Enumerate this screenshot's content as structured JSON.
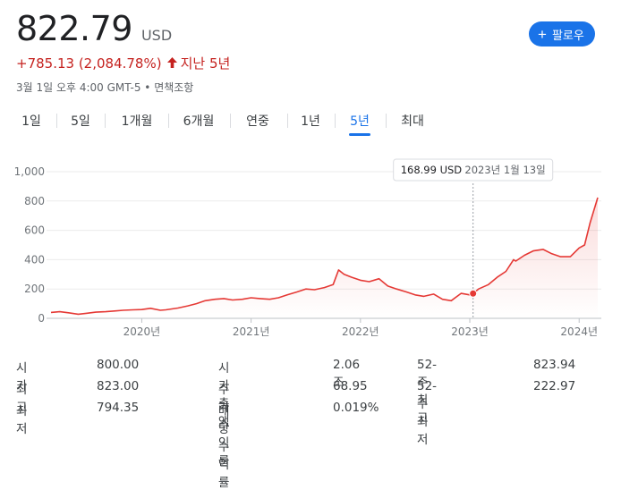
{
  "quote": {
    "price": "822.79",
    "currency": "USD",
    "change": "+785.13 (2,084.78%)",
    "arrow_icon": "arrow-up-icon",
    "period_label": "지난 5년",
    "timestamp": "3월 1일 오후 4:00 GMT-5 • 면책조항"
  },
  "follow_button": {
    "label": "팔로우",
    "icon": "plus-icon",
    "color": "#1a73e8"
  },
  "tabs": [
    {
      "label": "1일",
      "active": false
    },
    {
      "label": "5일",
      "active": false
    },
    {
      "label": "1개월",
      "active": false
    },
    {
      "label": "6개월",
      "active": false
    },
    {
      "label": "연중",
      "active": false
    },
    {
      "label": "1년",
      "active": false
    },
    {
      "label": "5년",
      "active": true
    },
    {
      "label": "최대",
      "active": false
    }
  ],
  "tooltip": {
    "price": "168.99 USD",
    "date": "2023년 1월 13일"
  },
  "chart_data": {
    "type": "area",
    "line_color": "#e53935",
    "grid": true,
    "ylim": [
      0,
      1000
    ],
    "yticks": [
      "1,000",
      "800",
      "600",
      "400",
      "200",
      "0"
    ],
    "ytick_values": [
      1000,
      800,
      600,
      400,
      200,
      0
    ],
    "xticks": [
      "2020년",
      "2021년",
      "2022년",
      "2023년",
      "2024년"
    ],
    "xtick_values": [
      2020.0,
      2021.0,
      2022.0,
      2023.0,
      2024.0
    ],
    "xlim": [
      2019.17,
      2024.17
    ],
    "highlight": {
      "x": 2023.03,
      "y": 168.99
    },
    "series": [
      {
        "x": [
          2019.17,
          2019.25,
          2019.33,
          2019.42,
          2019.5,
          2019.58,
          2019.67,
          2019.75,
          2019.83,
          2019.92,
          2020.0,
          2020.08,
          2020.17,
          2020.22,
          2020.33,
          2020.42,
          2020.5,
          2020.58,
          2020.67,
          2020.75,
          2020.83,
          2020.92,
          2021.0,
          2021.08,
          2021.17,
          2021.25,
          2021.33,
          2021.42,
          2021.5,
          2021.58,
          2021.67,
          2021.75,
          2021.8,
          2021.85,
          2021.92,
          2022.0,
          2022.08,
          2022.17,
          2022.25,
          2022.33,
          2022.42,
          2022.5,
          2022.58,
          2022.67,
          2022.75,
          2022.83,
          2022.92,
          2023.0,
          2023.03,
          2023.08,
          2023.17,
          2023.25,
          2023.33,
          2023.4,
          2023.42,
          2023.5,
          2023.58,
          2023.67,
          2023.75,
          2023.83,
          2023.92,
          2024.0,
          2024.05,
          2024.1,
          2024.17
        ],
        "y": [
          40,
          45,
          38,
          28,
          35,
          42,
          45,
          50,
          55,
          58,
          60,
          68,
          55,
          58,
          70,
          85,
          100,
          120,
          130,
          135,
          125,
          130,
          140,
          135,
          130,
          140,
          160,
          180,
          200,
          195,
          210,
          230,
          330,
          300,
          280,
          260,
          250,
          270,
          220,
          200,
          180,
          160,
          150,
          165,
          130,
          120,
          170,
          160,
          169,
          200,
          230,
          280,
          320,
          400,
          390,
          430,
          460,
          470,
          440,
          420,
          420,
          480,
          500,
          650,
          823
        ]
      }
    ]
  },
  "stats": {
    "col1": [
      {
        "label": "시가",
        "value": "800.00"
      },
      {
        "label": "최고",
        "value": "823.00"
      },
      {
        "label": "최저",
        "value": "794.35"
      }
    ],
    "col2": [
      {
        "label": "시가총액",
        "value": "2.06조"
      },
      {
        "label": "주가수익률",
        "value": "68.95"
      },
      {
        "label": "배당수익률",
        "value": "0.019%"
      }
    ],
    "col3": [
      {
        "label": "52-주 최고",
        "value": "823.94"
      },
      {
        "label": "52-주 최저",
        "value": "222.97"
      }
    ]
  }
}
